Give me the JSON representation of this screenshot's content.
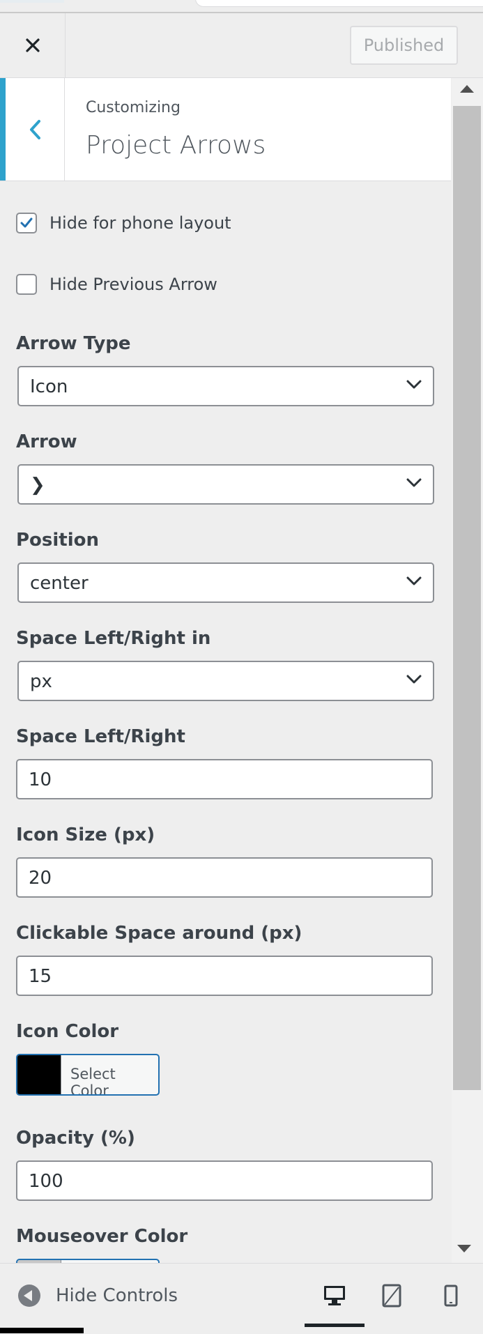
{
  "header": {
    "close_icon": "close-icon",
    "published_label": "Published"
  },
  "section": {
    "crumb": "Customizing",
    "title": "Project Arrows"
  },
  "controls": {
    "hide_phone": {
      "label": "Hide for phone layout",
      "checked": true
    },
    "hide_previous": {
      "label": "Hide Previous Arrow",
      "checked": false
    },
    "arrow_type": {
      "label": "Arrow Type",
      "value": "Icon"
    },
    "arrow": {
      "label": "Arrow",
      "value": "❯"
    },
    "position": {
      "label": "Position",
      "value": "center"
    },
    "space_unit": {
      "label": "Space Left/Right in",
      "value": "px"
    },
    "space": {
      "label": "Space Left/Right",
      "value": "10"
    },
    "icon_size": {
      "label": "Icon Size (px)",
      "value": "20"
    },
    "clickable_space": {
      "label": "Clickable Space around (px)",
      "value": "15"
    },
    "icon_color": {
      "label": "Icon Color",
      "button": "Select Color",
      "color": "#000000"
    },
    "opacity": {
      "label": "Opacity (%)",
      "value": "100"
    },
    "mouseover_color": {
      "label": "Mouseover Color"
    }
  },
  "footer": {
    "hide_controls": "Hide Controls",
    "devices": [
      "desktop-icon",
      "tablet-icon",
      "mobile-icon"
    ],
    "active_device": "desktop"
  },
  "colors": {
    "accent": "#2ea2cc",
    "button_border": "#2271b1"
  }
}
